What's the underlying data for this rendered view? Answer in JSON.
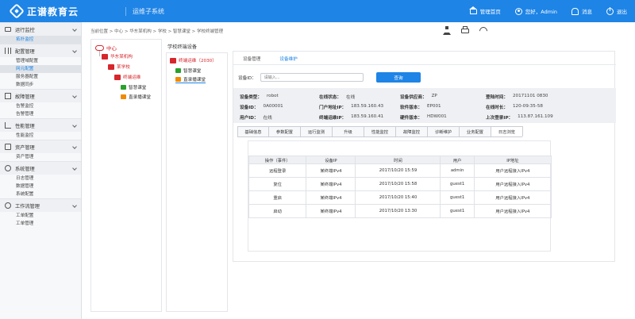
{
  "header": {
    "brand": "正谱教育云",
    "subsystem": "运维子系统",
    "nav": {
      "home": "管理首页",
      "greeting": "您好，Admin",
      "messages": "消息",
      "logout": "退出"
    }
  },
  "sidebar": {
    "groups": [
      {
        "label": "运行监控",
        "items": [
          "拓扑监控"
        ]
      },
      {
        "label": "配置管理",
        "items": [
          "管理域配置",
          "网元配置",
          "服务器配置",
          "数据同步"
        ]
      },
      {
        "label": "故障管理",
        "items": [
          "告警监控",
          "告警管理"
        ]
      },
      {
        "label": "性能管理",
        "items": [
          "性能监控"
        ]
      },
      {
        "label": "资产管理",
        "items": [
          "资产管理"
        ]
      },
      {
        "label": "系统管理",
        "items": [
          "日志管理",
          "数据管理",
          "系统配置"
        ]
      },
      {
        "label": "工作流管理",
        "items": [
          "工单配置",
          "工单管理"
        ]
      }
    ]
  },
  "breadcrumb": "当前位置 > 中心 > 华东某机构 > 学校 > 智慧课堂 > 学校终端管理",
  "tree": {
    "center": "中心",
    "org": "华东某机构",
    "school": "某学校",
    "terminal": "终端运维",
    "smart": "智慧课堂",
    "record": "直录播课堂"
  },
  "device_panel": {
    "title": "学校终端设备",
    "terminal": "终端运维（2030）",
    "smart": "智慧课堂",
    "record": "直录播课堂"
  },
  "detail": {
    "tabs": [
      "设备管理",
      "设备维护"
    ],
    "id_label": "设备ID：",
    "id_placeholder": "请输入...",
    "query_button": "查询",
    "info": {
      "type_k": "设备类型：",
      "type_v": "robot",
      "online_k": "在线状态：",
      "online_v": "在线",
      "vendor_k": "设备供应商：",
      "vendor_v": "ZP",
      "login_k": "登陆时间：",
      "login_v": "20171101 0830",
      "devid_k": "设备ID：",
      "devid_v": "0A00001",
      "gwip_k": "门户地址IP：",
      "gwip_v": "183.59.160.43",
      "sw_k": "软件版本：",
      "sw_v": "EP001",
      "onlinetime_k": "在线时长：",
      "onlinetime_v": "120-09:35-58",
      "userid_k": "用户ID：",
      "userid_v": "在线",
      "opip_k": "终端运维IP：",
      "opip_v": "183.59.160.41",
      "hw_k": "硬件版本：",
      "hw_v": "HDW001",
      "lastip_k": "上次登录IP：",
      "lastip_v": "113.87.161.109"
    },
    "subtabs": [
      "基础信息",
      "参数配置",
      "运行监测",
      "升级",
      "性能监控",
      "故障监控",
      "诊断维护",
      "业务配置",
      "日志浏览"
    ],
    "log": {
      "headers": [
        "操作（事件）",
        "设备IP",
        "时间",
        "用户",
        "IP地址"
      ],
      "rows": [
        [
          "远程登录",
          "某终端IPv4",
          "2017/10/20 15:59",
          "admin",
          "用户远程接入IPv4"
        ],
        [
          "复位",
          "某终端IPv4",
          "2017/10/20 15:58",
          "guest1",
          "用户远程接入IPv4"
        ],
        [
          "重启",
          "某终端IPv4",
          "2017/10/20 15:40",
          "guest1",
          "用户远程接入IPv4"
        ],
        [
          "启动",
          "某终端IPv4",
          "2017/10/20 13:30",
          "guest1",
          "用户远程接入IPv4"
        ]
      ]
    }
  }
}
